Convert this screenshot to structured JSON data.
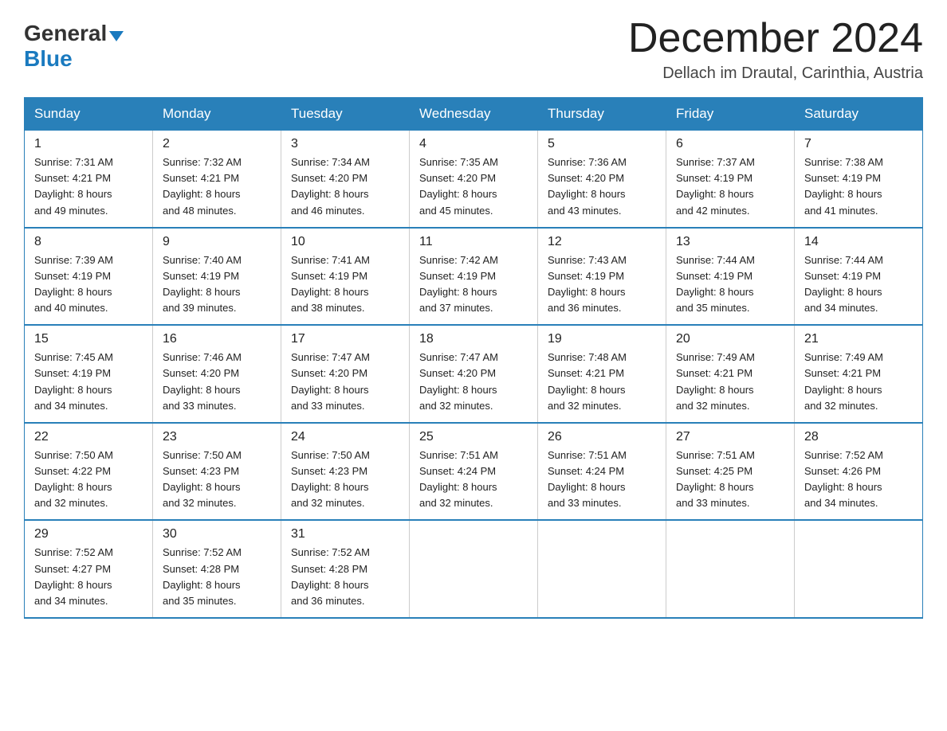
{
  "header": {
    "logo_general": "General",
    "logo_blue": "Blue",
    "main_title": "December 2024",
    "subtitle": "Dellach im Drautal, Carinthia, Austria"
  },
  "weekdays": [
    "Sunday",
    "Monday",
    "Tuesday",
    "Wednesday",
    "Thursday",
    "Friday",
    "Saturday"
  ],
  "weeks": [
    [
      {
        "num": "1",
        "sunrise": "7:31 AM",
        "sunset": "4:21 PM",
        "daylight": "8 hours and 49 minutes."
      },
      {
        "num": "2",
        "sunrise": "7:32 AM",
        "sunset": "4:21 PM",
        "daylight": "8 hours and 48 minutes."
      },
      {
        "num": "3",
        "sunrise": "7:34 AM",
        "sunset": "4:20 PM",
        "daylight": "8 hours and 46 minutes."
      },
      {
        "num": "4",
        "sunrise": "7:35 AM",
        "sunset": "4:20 PM",
        "daylight": "8 hours and 45 minutes."
      },
      {
        "num": "5",
        "sunrise": "7:36 AM",
        "sunset": "4:20 PM",
        "daylight": "8 hours and 43 minutes."
      },
      {
        "num": "6",
        "sunrise": "7:37 AM",
        "sunset": "4:19 PM",
        "daylight": "8 hours and 42 minutes."
      },
      {
        "num": "7",
        "sunrise": "7:38 AM",
        "sunset": "4:19 PM",
        "daylight": "8 hours and 41 minutes."
      }
    ],
    [
      {
        "num": "8",
        "sunrise": "7:39 AM",
        "sunset": "4:19 PM",
        "daylight": "8 hours and 40 minutes."
      },
      {
        "num": "9",
        "sunrise": "7:40 AM",
        "sunset": "4:19 PM",
        "daylight": "8 hours and 39 minutes."
      },
      {
        "num": "10",
        "sunrise": "7:41 AM",
        "sunset": "4:19 PM",
        "daylight": "8 hours and 38 minutes."
      },
      {
        "num": "11",
        "sunrise": "7:42 AM",
        "sunset": "4:19 PM",
        "daylight": "8 hours and 37 minutes."
      },
      {
        "num": "12",
        "sunrise": "7:43 AM",
        "sunset": "4:19 PM",
        "daylight": "8 hours and 36 minutes."
      },
      {
        "num": "13",
        "sunrise": "7:44 AM",
        "sunset": "4:19 PM",
        "daylight": "8 hours and 35 minutes."
      },
      {
        "num": "14",
        "sunrise": "7:44 AM",
        "sunset": "4:19 PM",
        "daylight": "8 hours and 34 minutes."
      }
    ],
    [
      {
        "num": "15",
        "sunrise": "7:45 AM",
        "sunset": "4:19 PM",
        "daylight": "8 hours and 34 minutes."
      },
      {
        "num": "16",
        "sunrise": "7:46 AM",
        "sunset": "4:20 PM",
        "daylight": "8 hours and 33 minutes."
      },
      {
        "num": "17",
        "sunrise": "7:47 AM",
        "sunset": "4:20 PM",
        "daylight": "8 hours and 33 minutes."
      },
      {
        "num": "18",
        "sunrise": "7:47 AM",
        "sunset": "4:20 PM",
        "daylight": "8 hours and 32 minutes."
      },
      {
        "num": "19",
        "sunrise": "7:48 AM",
        "sunset": "4:21 PM",
        "daylight": "8 hours and 32 minutes."
      },
      {
        "num": "20",
        "sunrise": "7:49 AM",
        "sunset": "4:21 PM",
        "daylight": "8 hours and 32 minutes."
      },
      {
        "num": "21",
        "sunrise": "7:49 AM",
        "sunset": "4:21 PM",
        "daylight": "8 hours and 32 minutes."
      }
    ],
    [
      {
        "num": "22",
        "sunrise": "7:50 AM",
        "sunset": "4:22 PM",
        "daylight": "8 hours and 32 minutes."
      },
      {
        "num": "23",
        "sunrise": "7:50 AM",
        "sunset": "4:23 PM",
        "daylight": "8 hours and 32 minutes."
      },
      {
        "num": "24",
        "sunrise": "7:50 AM",
        "sunset": "4:23 PM",
        "daylight": "8 hours and 32 minutes."
      },
      {
        "num": "25",
        "sunrise": "7:51 AM",
        "sunset": "4:24 PM",
        "daylight": "8 hours and 32 minutes."
      },
      {
        "num": "26",
        "sunrise": "7:51 AM",
        "sunset": "4:24 PM",
        "daylight": "8 hours and 33 minutes."
      },
      {
        "num": "27",
        "sunrise": "7:51 AM",
        "sunset": "4:25 PM",
        "daylight": "8 hours and 33 minutes."
      },
      {
        "num": "28",
        "sunrise": "7:52 AM",
        "sunset": "4:26 PM",
        "daylight": "8 hours and 34 minutes."
      }
    ],
    [
      {
        "num": "29",
        "sunrise": "7:52 AM",
        "sunset": "4:27 PM",
        "daylight": "8 hours and 34 minutes."
      },
      {
        "num": "30",
        "sunrise": "7:52 AM",
        "sunset": "4:28 PM",
        "daylight": "8 hours and 35 minutes."
      },
      {
        "num": "31",
        "sunrise": "7:52 AM",
        "sunset": "4:28 PM",
        "daylight": "8 hours and 36 minutes."
      },
      null,
      null,
      null,
      null
    ]
  ]
}
